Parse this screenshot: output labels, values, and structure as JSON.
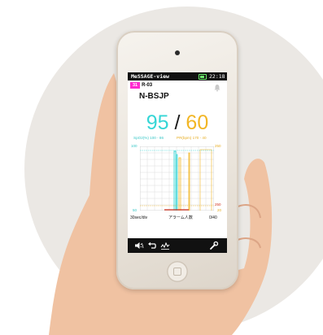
{
  "device": {
    "status_bar": {
      "app_name": "MeSSAGE-view",
      "time": "22:18"
    },
    "bed": {
      "badge": "31",
      "label": "R-03"
    },
    "patient_id": "N-BSJP",
    "vitals": {
      "spo2": "95",
      "separator": "/",
      "pr": "60"
    },
    "limits": {
      "spo2": "SpO2(%)  100 -  86",
      "pr": "PR(bpm) 170 -  40"
    },
    "graph": {
      "spo2_axis": {
        "top": "100",
        "bottom": "50"
      },
      "pr_axis": {
        "top": "250",
        "mid": "250",
        "bottom": "20"
      }
    },
    "footer": {
      "scale": "30sec/div",
      "alarm_label": "アラーム人数",
      "alarm_count": "0/40"
    },
    "toolbar_icons": [
      "mute-icon",
      "back-icon",
      "wave-icon",
      "wrench-icon"
    ],
    "colors": {
      "spo2": "#36d6d6",
      "pr": "#f2b625",
      "badge": "#ff2bd0"
    }
  }
}
